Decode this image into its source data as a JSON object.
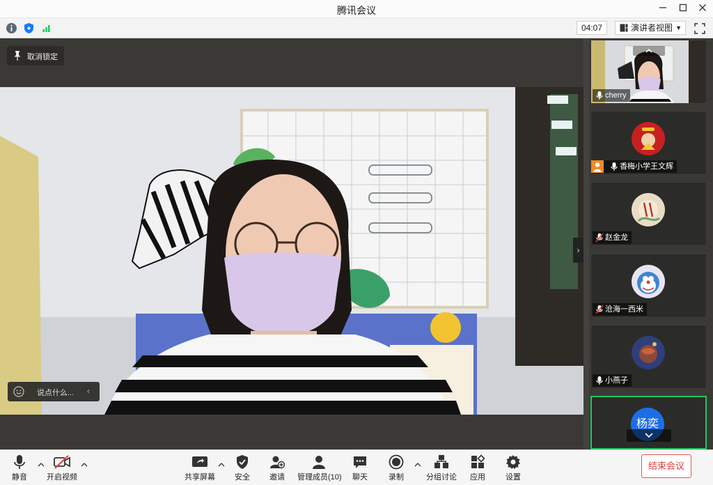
{
  "window": {
    "title": "腾讯会议"
  },
  "infobar": {
    "timer": "04:07",
    "view_label": "演讲者视图",
    "colors": {
      "info": "#5d6670",
      "shield": "#1677ff",
      "signal": "#22c55e"
    }
  },
  "main": {
    "unlock_label": "取消锁定",
    "chat_placeholder": "说点什么..."
  },
  "participants": [
    {
      "name": "cherry",
      "muted": false,
      "video": true
    },
    {
      "name": "香梅小学王文辉",
      "muted": false,
      "video": false,
      "host": true
    },
    {
      "name": "赵金龙",
      "muted": true,
      "video": false
    },
    {
      "name": "沧海一西米",
      "muted": true,
      "video": false
    },
    {
      "name": "小燕子",
      "muted": false,
      "video": false
    },
    {
      "name": "杨奕",
      "avatar_text": "杨奕",
      "active": true
    }
  ],
  "toolbar": {
    "mute": "静音",
    "video": "开启视频",
    "share": "共享屏幕",
    "security": "安全",
    "invite": "邀请",
    "members": "管理成员(10)",
    "chat": "聊天",
    "record": "录制",
    "breakout": "分组讨论",
    "apps": "应用",
    "settings": "设置",
    "end": "结束会议",
    "colors": {
      "end": "#e03c3c",
      "video_off": "#e53935"
    }
  }
}
